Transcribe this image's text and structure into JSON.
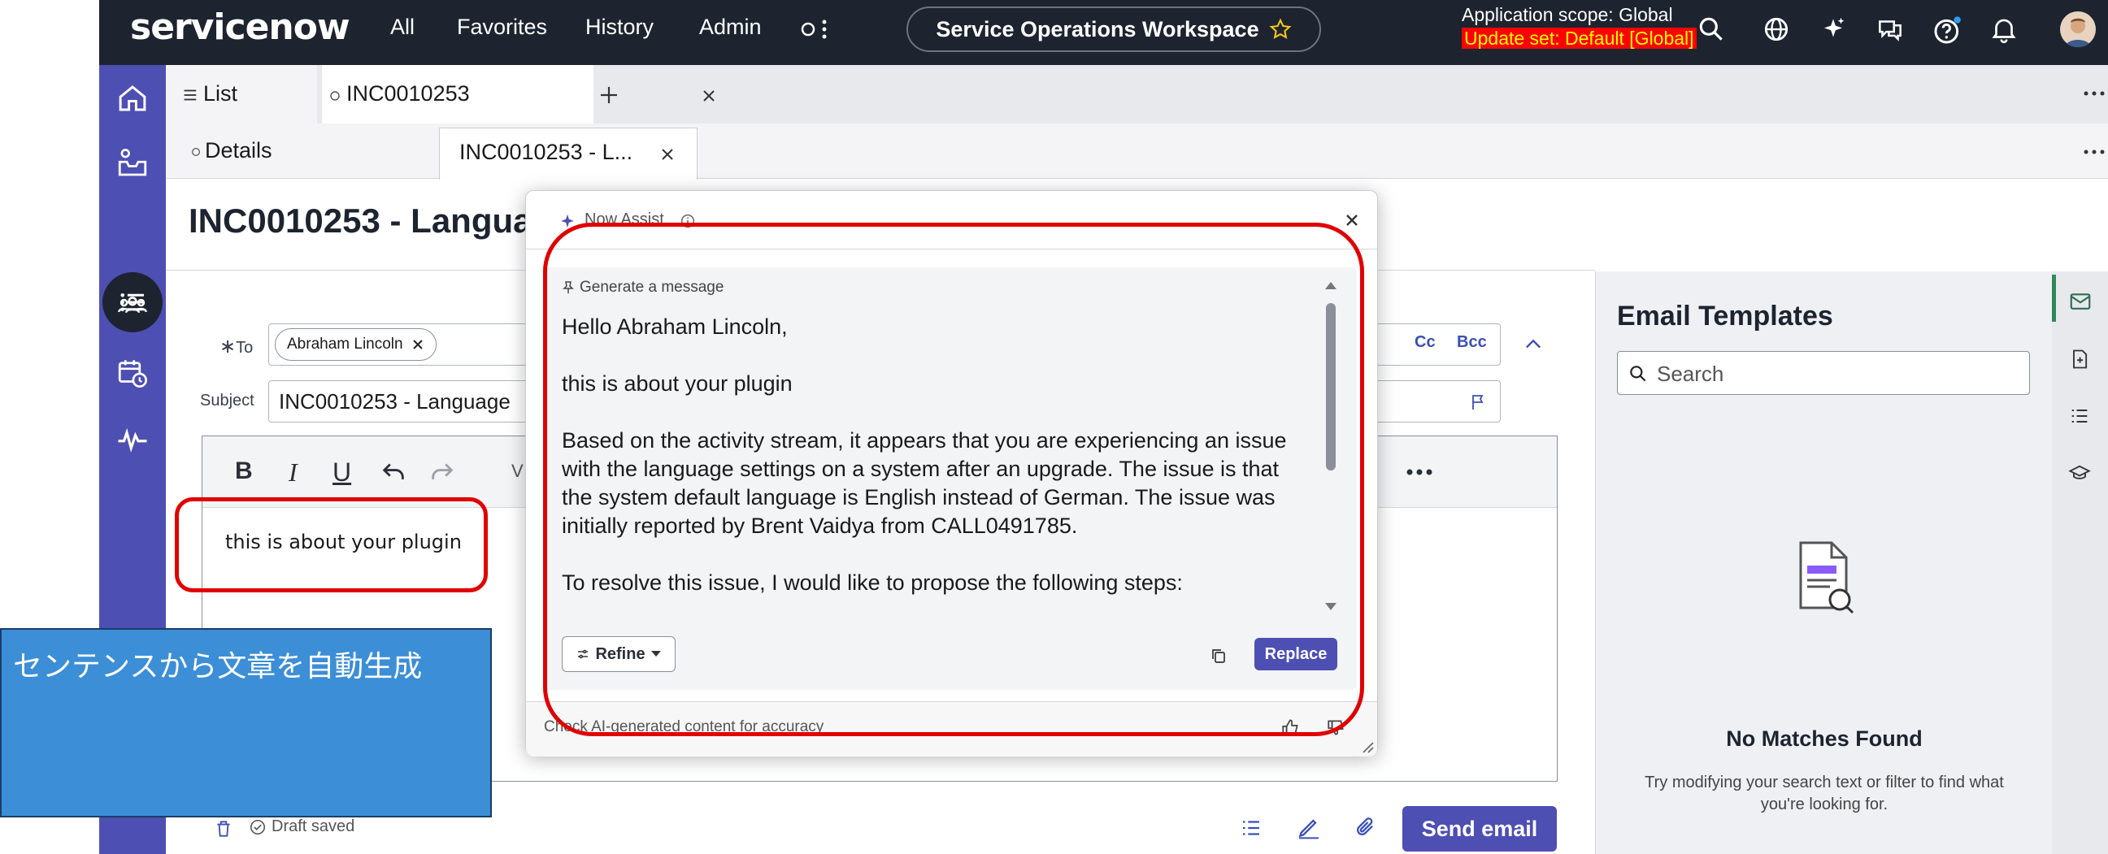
{
  "topbar": {
    "logo": "servicenow",
    "nav": [
      "All",
      "Favorites",
      "History",
      "Admin"
    ],
    "workspace": "Service Operations Workspace",
    "scope_line": "Application scope: Global",
    "update_set": "Update set: Default [Global]"
  },
  "tabs": {
    "primary": [
      {
        "label": "List"
      },
      {
        "label": "INC0010253"
      }
    ],
    "secondary": [
      {
        "label": "Details"
      },
      {
        "label": "INC0010253 - L..."
      }
    ]
  },
  "record": {
    "title": "INC0010253 - Languag"
  },
  "composer": {
    "to_label": "To",
    "to_chip": "Abraham Lincoln",
    "cc": "Cc",
    "bcc": "Bcc",
    "subject_label": "Subject",
    "subject_value": "INC0010253 - Language",
    "body_text": "this is about your plugin",
    "draft_status": "Draft saved",
    "send_label": "Send email",
    "toolbar_v": "V"
  },
  "callout": {
    "text": "センテンスから文章を自動生成"
  },
  "now_assist": {
    "title": "Now Assist",
    "section": "Generate a message",
    "paragraphs": [
      "Hello Abraham Lincoln,",
      "this is about your plugin",
      "Based on the activity stream, it appears that you are experiencing an issue with the language settings on a system after an upgrade. The issue is that the system default language is English instead of German. The issue was initially reported by Brent Vaidya from CALL0491785.",
      "To resolve this issue, I would like to propose the following steps:"
    ],
    "refine_label": "Refine",
    "replace_label": "Replace",
    "footer_note": "Check AI-generated content for accuracy"
  },
  "templates": {
    "title": "Email Templates",
    "search_placeholder": "Search",
    "empty_title": "No Matches Found",
    "empty_hint": "Try modifying your search text or filter to find what you're looking for."
  },
  "colors": {
    "topbar": "#1d2430",
    "rail": "#4e4fb3",
    "accent": "#4e4fb3",
    "highlight": "#e00000",
    "callout": "#3c8ed6",
    "update_set_bg": "#ff0000",
    "update_set_fg": "#ffff00"
  }
}
